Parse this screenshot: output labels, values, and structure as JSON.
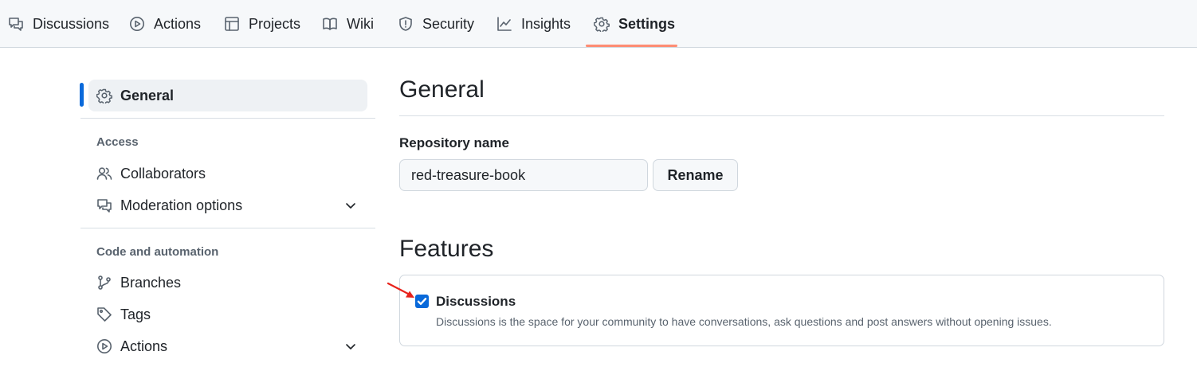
{
  "topnav": {
    "tabs": [
      {
        "label": "Discussions",
        "icon": "comment-discussion-icon",
        "active": false
      },
      {
        "label": "Actions",
        "icon": "play-circle-icon",
        "active": false
      },
      {
        "label": "Projects",
        "icon": "table-icon",
        "active": false
      },
      {
        "label": "Wiki",
        "icon": "book-icon",
        "active": false
      },
      {
        "label": "Security",
        "icon": "shield-icon",
        "active": false
      },
      {
        "label": "Insights",
        "icon": "graph-icon",
        "active": false
      },
      {
        "label": "Settings",
        "icon": "gear-icon",
        "active": true
      }
    ],
    "active_underline_color": "#fd8c73"
  },
  "sidebar": {
    "general": {
      "label": "General",
      "icon": "gear-icon",
      "active": true
    },
    "sections": [
      {
        "heading": "Access",
        "items": [
          {
            "label": "Collaborators",
            "icon": "people-icon",
            "expandable": false
          },
          {
            "label": "Moderation options",
            "icon": "comment-discussion-icon",
            "expandable": true
          }
        ]
      },
      {
        "heading": "Code and automation",
        "items": [
          {
            "label": "Branches",
            "icon": "git-branch-icon",
            "expandable": false
          },
          {
            "label": "Tags",
            "icon": "tag-icon",
            "expandable": false
          },
          {
            "label": "Actions",
            "icon": "play-circle-icon",
            "expandable": true
          }
        ]
      }
    ],
    "accent_color": "#0969da"
  },
  "main": {
    "title": "General",
    "repo_name_label": "Repository name",
    "repo_name_value": "red-treasure-book",
    "rename_label": "Rename",
    "features_title": "Features",
    "features": [
      {
        "label": "Discussions",
        "checked": true,
        "description": "Discussions is the space for your community to have conversations, ask questions and post answers without opening issues."
      }
    ],
    "annotation_arrow_color": "#e8221b"
  }
}
